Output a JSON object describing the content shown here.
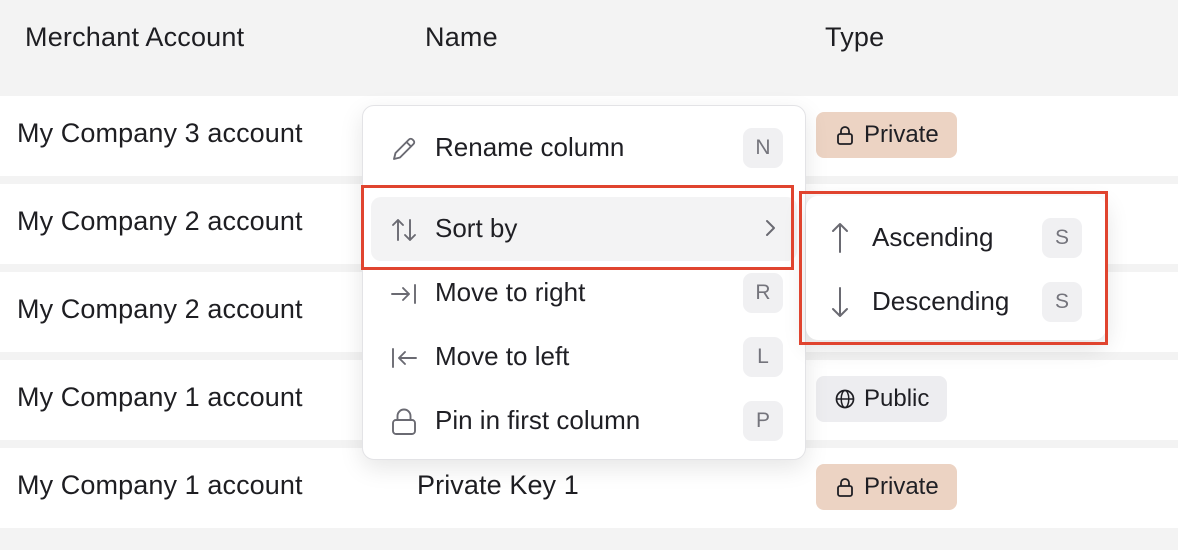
{
  "table": {
    "columns": [
      "Merchant Account",
      "Name",
      "Type"
    ],
    "rows": [
      {
        "account": "My Company 3 account",
        "name": "",
        "type": "Private"
      },
      {
        "account": "My Company 2 account",
        "name": "",
        "type": ""
      },
      {
        "account": "My Company 2 account",
        "name": "",
        "type": ""
      },
      {
        "account": "My Company 1 account",
        "name": "",
        "type": "Public"
      },
      {
        "account": "My Company 1 account",
        "name": "Private Key 1",
        "type": "Private"
      }
    ]
  },
  "column_menu": {
    "items": [
      {
        "label": "Rename column",
        "shortcut": "N",
        "icon": "pencil-icon"
      },
      {
        "label": "Sort by",
        "shortcut": "",
        "icon": "sort-arrows-icon",
        "has_submenu": true,
        "active": true
      },
      {
        "label": "Move to right",
        "shortcut": "R",
        "icon": "arrow-to-right-icon"
      },
      {
        "label": "Move to left",
        "shortcut": "L",
        "icon": "arrow-to-left-icon"
      },
      {
        "label": "Pin in first column",
        "shortcut": "P",
        "icon": "lock-icon"
      }
    ]
  },
  "sort_submenu": {
    "items": [
      {
        "label": "Ascending",
        "shortcut": "S",
        "icon": "arrow-up-icon"
      },
      {
        "label": "Descending",
        "shortcut": "S",
        "icon": "arrow-down-icon"
      }
    ]
  },
  "colors": {
    "highlight": "#e0442f",
    "private_badge": "#ecd3c3",
    "public_badge": "#ededf0"
  }
}
